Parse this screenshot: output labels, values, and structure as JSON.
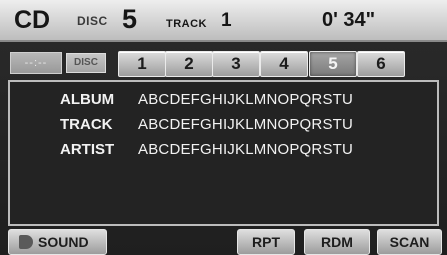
{
  "header": {
    "mode": "CD",
    "disc_label": "DISC",
    "disc_number": "5",
    "track_label": "TRACK",
    "track_number": "1",
    "elapsed_time": "0' 34\""
  },
  "disc_row": {
    "blank_indicator": "--:--",
    "disc_button_label": "DISC",
    "slots": [
      "1",
      "2",
      "3",
      "4",
      "5",
      "6"
    ],
    "active_slot": "5"
  },
  "info": {
    "album_label": "ALBUM",
    "album_value": "ABCDEFGHIJKLMNOPQRSTU",
    "track_label": "TRACK",
    "track_value": "ABCDEFGHIJKLMNOPQRSTU",
    "artist_label": "ARTIST",
    "artist_value": "ABCDEFGHIJKLMNOPQRSTU"
  },
  "buttons": {
    "sound": "SOUND",
    "repeat": "RPT",
    "random": "RDM",
    "scan": "SCAN"
  },
  "icons": {
    "sound": "speaker-icon"
  }
}
